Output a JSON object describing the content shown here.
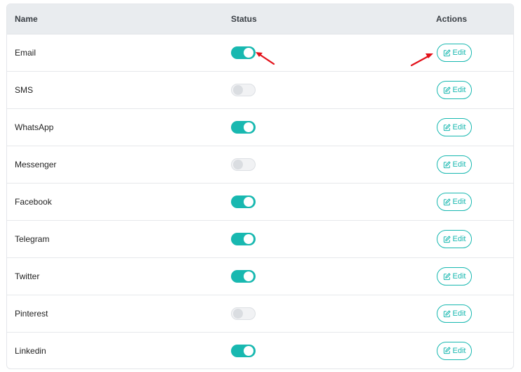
{
  "table": {
    "headers": {
      "name": "Name",
      "status": "Status",
      "actions": "Actions"
    },
    "edit_label": "Edit",
    "rows": [
      {
        "name": "Email",
        "enabled": true
      },
      {
        "name": "SMS",
        "enabled": false
      },
      {
        "name": "WhatsApp",
        "enabled": true
      },
      {
        "name": "Messenger",
        "enabled": false
      },
      {
        "name": "Facebook",
        "enabled": true
      },
      {
        "name": "Telegram",
        "enabled": true
      },
      {
        "name": "Twitter",
        "enabled": true
      },
      {
        "name": "Pinterest",
        "enabled": false
      },
      {
        "name": "Linkedin",
        "enabled": true
      }
    ]
  },
  "colors": {
    "accent": "#18b8b0",
    "annotation_arrow": "#e3111a"
  },
  "icons": {
    "edit": "edit-square-pen-icon"
  }
}
